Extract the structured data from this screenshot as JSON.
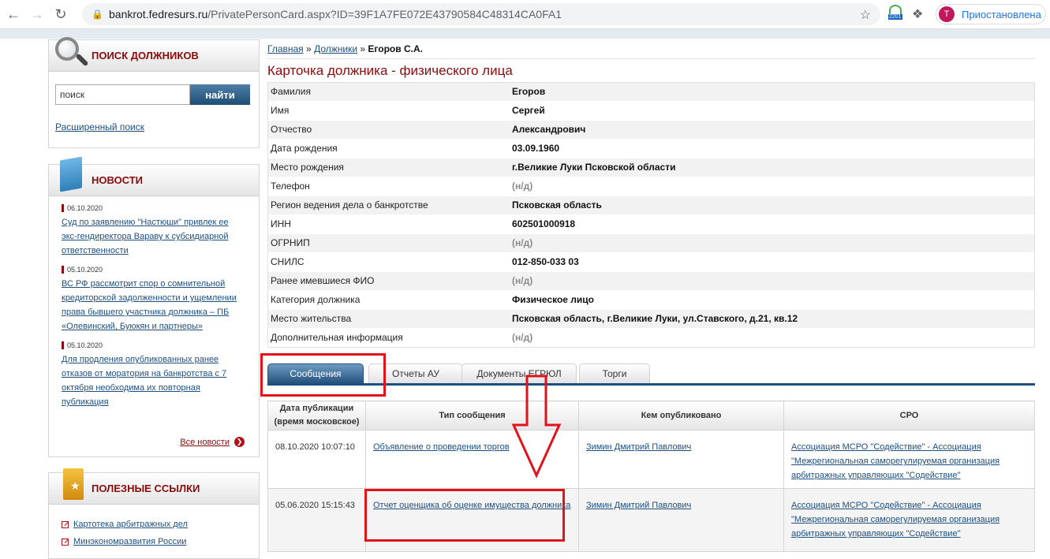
{
  "browser": {
    "url_host": "bankrot.fedresurs.ru",
    "url_rest": "/PrivatePersonCard.aspx?ID=39F1A7FE072E43790584C48314CA0FA1",
    "extension_badge": "2201",
    "profile_initial": "T",
    "profile_label": "Приостановлена"
  },
  "sidebar": {
    "search": {
      "title": "ПОИСК ДОЛЖНИКОВ",
      "placeholder": "поиск",
      "button": "найти",
      "advanced_link": "Расширенный поиск"
    },
    "news": {
      "title": "НОВОСТИ",
      "items": [
        {
          "date": "06.10.2020",
          "text": "Суд по заявлению \"Настюши\" привлек ее экс-гендиректора Вараву к субсидиарной ответственности"
        },
        {
          "date": "05.10.2020",
          "text": "ВС РФ рассмотрит спор о сомнительной кредиторской задолженности и ущемлении права бывшего участника должника – ПБ «Олевинский, Буюкян и партнеры»"
        },
        {
          "date": "05.10.2020",
          "text": "Для продления опубликованных ранее отказов от моратория на банкротства с 7 октября необходима их повторная публикация"
        }
      ],
      "all_link": "Все новости"
    },
    "useful": {
      "title": "ПОЛЕЗНЫЕ ССЫЛКИ",
      "items": [
        "Картотека арбитражных дел",
        "Минэкономразвития России"
      ]
    }
  },
  "breadcrumb": {
    "home": "Главная",
    "sep": "»",
    "debtors": "Должники",
    "current": "Егоров С.А."
  },
  "page_title": "Карточка должника - физического лица",
  "info": [
    {
      "key": "Фамилия",
      "value": "Егоров",
      "na": false
    },
    {
      "key": "Имя",
      "value": "Сергей",
      "na": false
    },
    {
      "key": "Отчество",
      "value": "Александрович",
      "na": false
    },
    {
      "key": "Дата рождения",
      "value": "03.09.1960",
      "na": false
    },
    {
      "key": "Место рождения",
      "value": "г.Великие Луки Псковской области",
      "na": false
    },
    {
      "key": "Телефон",
      "value": "(н/д)",
      "na": true
    },
    {
      "key": "Регион ведения дела о банкротстве",
      "value": "Псковская область",
      "na": false
    },
    {
      "key": "ИНН",
      "value": "602501000918",
      "na": false
    },
    {
      "key": "ОГРНИП",
      "value": "(н/д)",
      "na": true
    },
    {
      "key": "СНИЛС",
      "value": "012-850-033 03",
      "na": false
    },
    {
      "key": "Ранее имевшиеся ФИО",
      "value": "(н/д)",
      "na": true
    },
    {
      "key": "Категория должника",
      "value": "Физическое лицо",
      "na": false
    },
    {
      "key": "Место жительства",
      "value": "Псковская область, г.Великие Луки, ул.Ставского, д.21, кв.12",
      "na": false
    },
    {
      "key": "Дополнительная информация",
      "value": "(н/д)",
      "na": true
    }
  ],
  "tabs": [
    "Сообщения",
    "Отчеты АУ",
    "Документы ЕГРЮЛ",
    "Торги"
  ],
  "active_tab": 0,
  "messages": {
    "headers": [
      "Дата публикации (время московское)",
      "Тип сообщения",
      "Кем опубликовано",
      "СРО"
    ],
    "rows": [
      {
        "date": "08.10.2020 10:07:10",
        "type": "Объявление о проведении торгов",
        "publisher": "Зимин Дмитрий Павлович",
        "sro": "Ассоциация МСРО \"Содействие\" - Ассоциация \"Межрегиональная саморегулируемая организация арбитражных управляющих \"Содействие\""
      },
      {
        "date": "05.06.2020 15:15:43",
        "type": "Отчет оценщика об оценке имущества должника",
        "publisher": "Зимин Дмитрий Павлович",
        "sro": "Ассоциация МСРО \"Содействие\" - Ассоциация \"Межрегиональная саморегулируемая организация арбитражных управляющих \"Содействие\""
      }
    ]
  },
  "colors": {
    "annotation": "#e0131b",
    "title_red": "#8b0a0a",
    "link_blue": "#1e4f7f"
  }
}
